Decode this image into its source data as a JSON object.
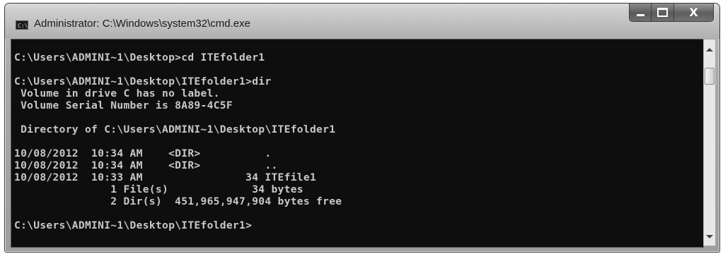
{
  "window": {
    "title": "Administrator: C:\\Windows\\system32\\cmd.exe",
    "app_icon": "cmd-icon",
    "app_icon_text": "C:\\"
  },
  "caption_buttons": {
    "minimize_icon": "minimize-icon",
    "maximize_icon": "maximize-icon",
    "close_icon": "close-icon",
    "close_glyph": "X"
  },
  "console": {
    "background": "#0e0e0e",
    "foreground": "#c8c8c8",
    "lines": [
      "C:\\Users\\ADMINI~1\\Desktop>cd ITEfolder1",
      "",
      "C:\\Users\\ADMINI~1\\Desktop\\ITEfolder1>dir",
      " Volume in drive C has no label.",
      " Volume Serial Number is 8A89-4C5F",
      "",
      " Directory of C:\\Users\\ADMINI~1\\Desktop\\ITEfolder1",
      "",
      "10/08/2012  10:34 AM    <DIR>          .",
      "10/08/2012  10:34 AM    <DIR>          ..",
      "10/08/2012  10:33 AM                34 ITEfile1",
      "               1 File(s)             34 bytes",
      "               2 Dir(s)  451,965,947,904 bytes free",
      "",
      "C:\\Users\\ADMINI~1\\Desktop\\ITEfolder1>"
    ]
  },
  "scrollbar": {
    "up_icon": "scroll-up-arrow-icon",
    "down_icon": "scroll-down-arrow-icon"
  }
}
